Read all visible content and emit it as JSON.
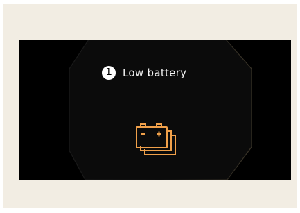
{
  "warning": {
    "number": "1",
    "message": "Low battery"
  },
  "icons": {
    "warning_number": "number-1-icon",
    "battery": "battery-stack-icon"
  },
  "colors": {
    "background_frame": "#f2ede3",
    "screen": "#000000",
    "battery_accent": "#f0a04a",
    "text": "#f2f2f2"
  }
}
